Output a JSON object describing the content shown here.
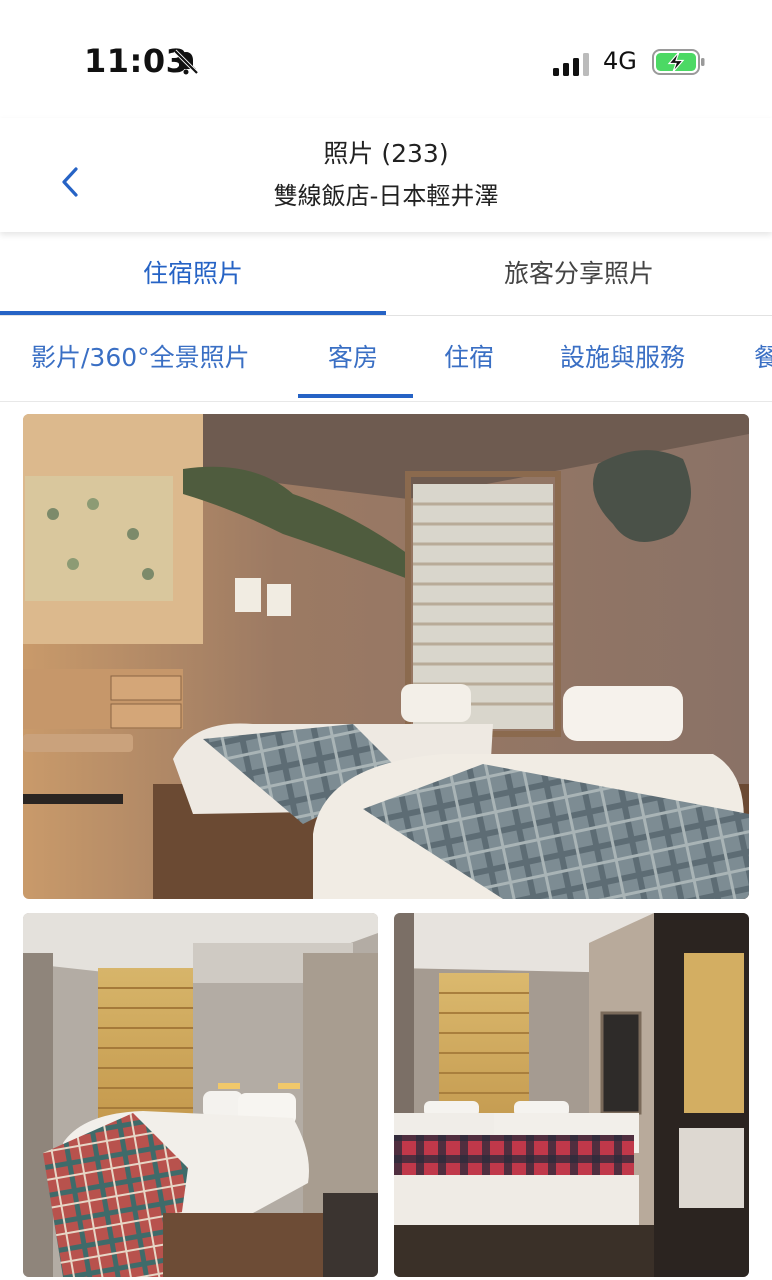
{
  "status_bar": {
    "time": "11:03",
    "network": "4G",
    "icons": [
      "bell-slash-icon",
      "signal-bars-icon",
      "battery-charging-icon"
    ]
  },
  "header": {
    "title": "照片 (233)",
    "subtitle": "雙線飯店-日本輕井澤",
    "back_icon": "chevron-left-icon"
  },
  "main_tabs": [
    {
      "label": "住宿照片",
      "active": true
    },
    {
      "label": "旅客分享照片",
      "active": false
    }
  ],
  "category_tabs": [
    {
      "label": "影片/360°全景照片",
      "active": false
    },
    {
      "label": "客房",
      "active": true
    },
    {
      "label": "住宿",
      "active": false
    },
    {
      "label": "設施與服務",
      "active": false
    },
    {
      "label": "餐",
      "active": false
    }
  ],
  "photos": [
    {
      "kind": "twin-room-plaid-blankets"
    },
    {
      "kind": "double-bed-red-plaid"
    },
    {
      "kind": "twin-room-red-check"
    }
  ],
  "colors": {
    "accent": "#2663c5",
    "tab_text": "#3a6fc4"
  }
}
